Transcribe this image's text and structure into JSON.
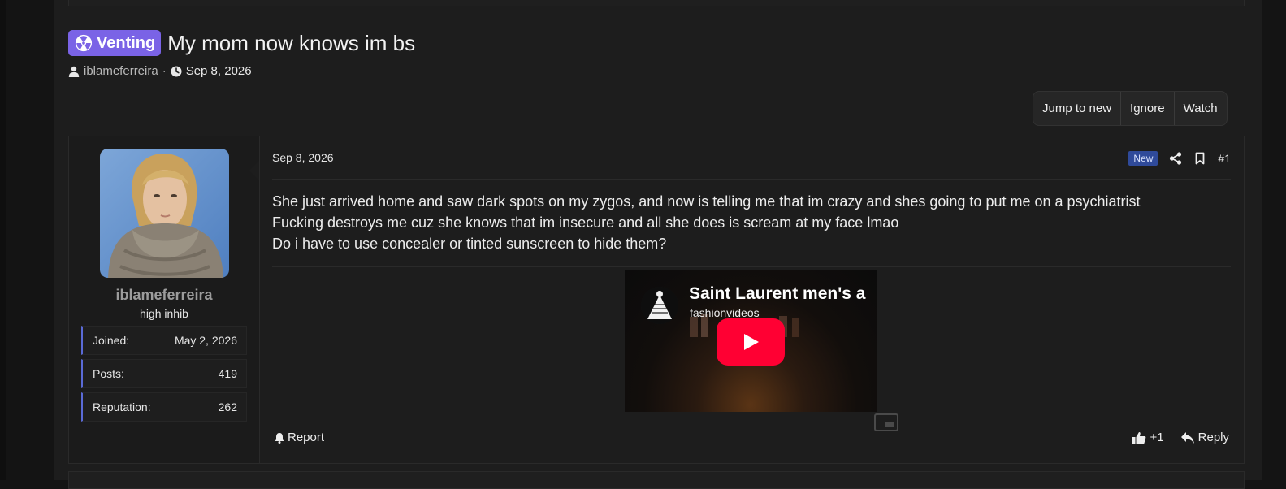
{
  "thread": {
    "prefix": "Venting",
    "title": "My mom now knows im bs",
    "author": "iblameferreira",
    "separator": "·",
    "date": "Sep 8, 2026"
  },
  "actions": {
    "jump_to_new": "Jump to new",
    "ignore": "Ignore",
    "watch": "Watch"
  },
  "post": {
    "date": "Sep 8, 2026",
    "new_badge": "New",
    "number": "#1",
    "lines": [
      "She just arrived home and saw dark spots on my zygos, and now is telling me that im crazy and shes going to put me on a psychiatrist",
      "Fucking destroys me cuz she knows that im insecure and all she does is scream at my face lmao",
      "Do i have to use concealer or tinted sunscreen to hide them?"
    ],
    "video": {
      "title": "Saint Laurent men's a",
      "channel": "fashionvideos"
    },
    "report_label": "Report",
    "like_count": "+1",
    "reply_label": "Reply"
  },
  "user": {
    "name": "iblameferreira",
    "title": "high inhib",
    "stats": [
      {
        "label": "Joined:",
        "value": "May 2, 2026"
      },
      {
        "label": "Posts:",
        "value": "419"
      },
      {
        "label": "Reputation:",
        "value": "262"
      }
    ]
  },
  "colors": {
    "prefix_bg": "#7a63e6",
    "new_badge_bg": "#2f4a9a",
    "stat_accent": "#5a6ad6",
    "youtube_red": "#ff0033"
  },
  "icons": [
    "radiation-icon",
    "user-icon",
    "clock-icon",
    "share-icon",
    "bookmark-icon",
    "bell-icon",
    "thumbs-up-icon",
    "reply-icon",
    "play-icon",
    "pip-icon"
  ]
}
